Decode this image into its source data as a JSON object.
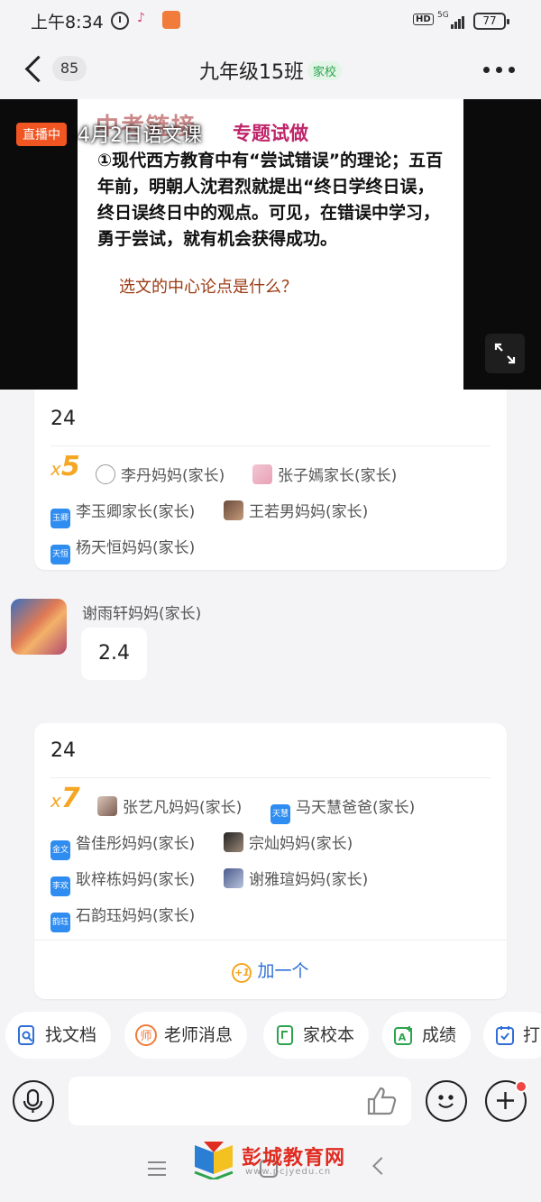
{
  "status_bar": {
    "time": "上午8:34",
    "network": "5G",
    "hd": "HD",
    "battery": "77"
  },
  "header": {
    "back_count": "85",
    "title": "九年级15班",
    "tag": "家校"
  },
  "live": {
    "badge": "直播中",
    "title": "4月2日语文课",
    "slide_header": "中考链接",
    "slide_topic": "专题试做",
    "slide_body": "①现代西方教育中有“尝试错误”的理论；五百年前，明朝人沈君烈就提出“终日学终日误，终日误终日中的观点。可见，在错误中学习，勇于尝试，就有机会获得成功。",
    "slide_question": "选文的中心论点是什么？"
  },
  "card1": {
    "number": "24",
    "x_prefix": "x",
    "count": "5",
    "people": [
      {
        "name": "李丹妈妈(家长)",
        "avatar": ""
      },
      {
        "name": "张子嫣家长(家长)",
        "avatar": ""
      },
      {
        "name": "李玉卿家长(家长)",
        "avatar": "玉卿"
      },
      {
        "name": "王若男妈妈(家长)",
        "avatar": ""
      },
      {
        "name": "杨天恒妈妈(家长)",
        "avatar": "天恒"
      }
    ]
  },
  "message": {
    "sender": "谢雨轩妈妈(家长)",
    "text": "2.4"
  },
  "card2": {
    "number": "24",
    "x_prefix": "x",
    "count": "7",
    "people": [
      {
        "name": "张艺凡妈妈(家长)",
        "avatar": ""
      },
      {
        "name": "马天慧爸爸(家长)",
        "avatar": "天慧"
      },
      {
        "name": "昝佳彤妈妈(家长)",
        "avatar": "金文"
      },
      {
        "name": "宗灿妈妈(家长)",
        "avatar": ""
      },
      {
        "name": "耿梓栋妈妈(家长)",
        "avatar": "李欢"
      },
      {
        "name": "谢雅瑄妈妈(家长)",
        "avatar": ""
      },
      {
        "name": "石韵珏妈妈(家长)",
        "avatar": "韵珏"
      }
    ],
    "add_one_icon": "+1",
    "add_one": "加一个"
  },
  "chips": [
    "找文档",
    "老师消息",
    "家校本",
    "成绩",
    "打"
  ],
  "input": {
    "placeholder": ""
  },
  "watermark": {
    "text": "彭城教育网",
    "url": "www.pcjyedu.cn"
  },
  "colors": {
    "accent_orange": "#f5a623",
    "live_red": "#f05522",
    "link_blue": "#2f6fd6"
  }
}
